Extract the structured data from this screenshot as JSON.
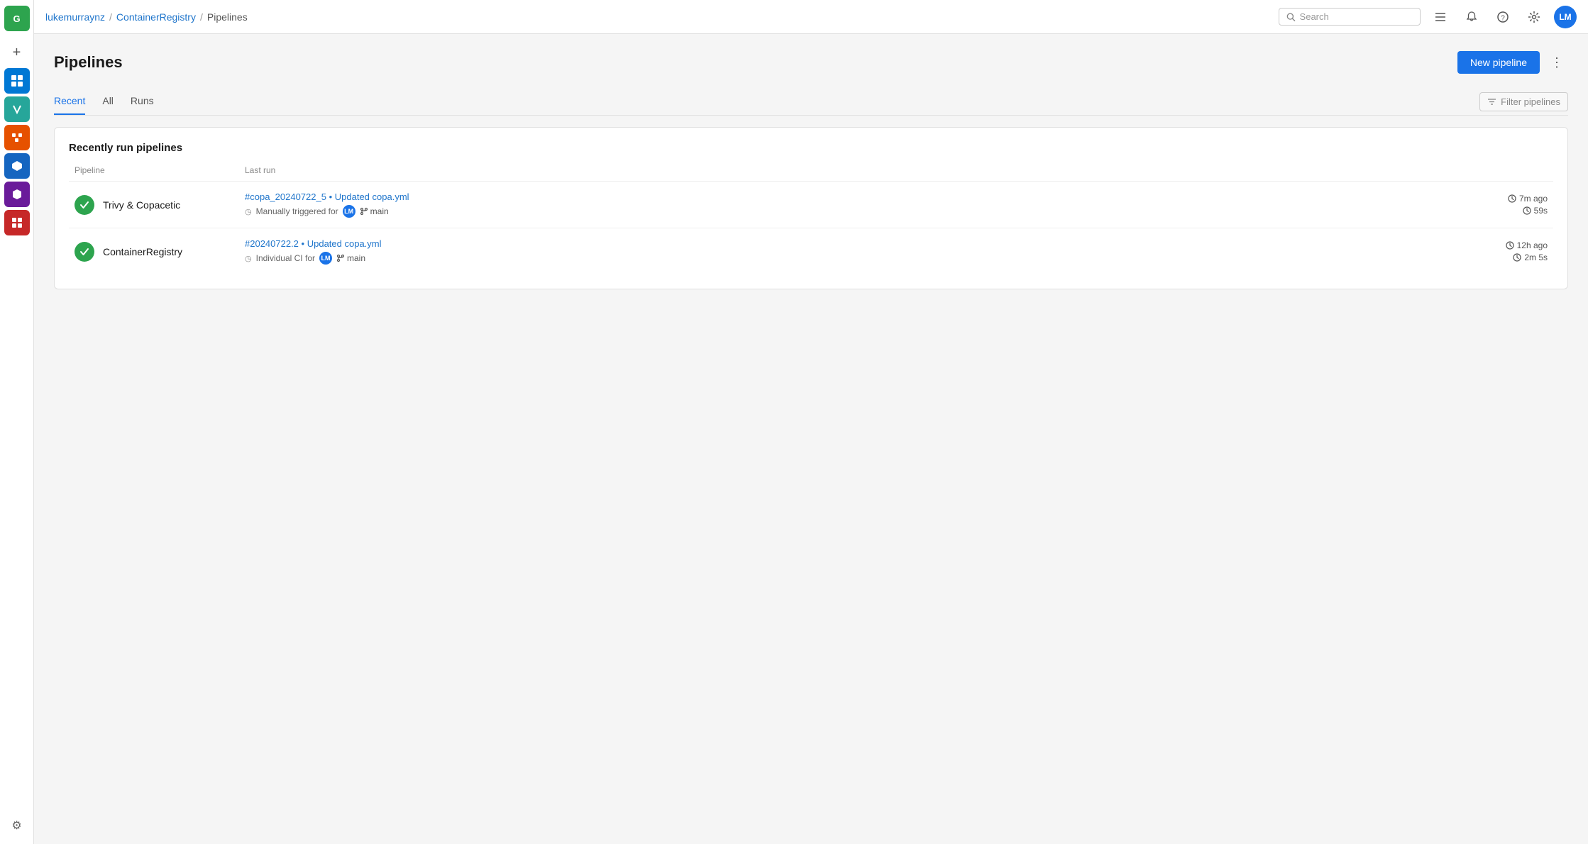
{
  "app": {
    "logo_text": "G"
  },
  "topnav": {
    "breadcrumb": {
      "user": "lukemurraynz",
      "sep1": "/",
      "project": "ContainerRegistry",
      "sep2": "/",
      "page": "Pipelines"
    },
    "search": {
      "placeholder": "Search"
    },
    "avatar": {
      "initials": "LM"
    }
  },
  "sidebar": {
    "items": [
      {
        "id": "overview",
        "icon": "⊞",
        "color": "green"
      },
      {
        "id": "add",
        "icon": "+",
        "color": ""
      },
      {
        "id": "boards",
        "icon": "▦",
        "color": "blue-icon"
      },
      {
        "id": "repos",
        "icon": "✓",
        "color": "teal"
      },
      {
        "id": "pipelines",
        "icon": "⚙",
        "color": "orange"
      },
      {
        "id": "testplans",
        "icon": "⬡",
        "color": "blue-icon"
      },
      {
        "id": "artifacts",
        "icon": "⬢",
        "color": "purple"
      },
      {
        "id": "more",
        "icon": "■",
        "color": "red"
      }
    ],
    "settings_icon": "⚙"
  },
  "page": {
    "title": "Pipelines",
    "new_pipeline_btn": "New pipeline",
    "more_icon": "⋮"
  },
  "tabs": [
    {
      "id": "recent",
      "label": "Recent",
      "active": true
    },
    {
      "id": "all",
      "label": "All",
      "active": false
    },
    {
      "id": "runs",
      "label": "Runs",
      "active": false
    }
  ],
  "filter": {
    "placeholder": "Filter pipelines"
  },
  "pipelines_section": {
    "title": "Recently run pipelines",
    "col_pipeline": "Pipeline",
    "col_lastrun": "Last run",
    "pipelines": [
      {
        "id": 1,
        "name": "Trivy & Copacetic",
        "status": "success",
        "commit_ref": "#copa_20240722_5",
        "commit_msg": "Updated copa.yml",
        "trigger": "Manually triggered for",
        "user_initials": "LM",
        "branch": "main",
        "time_ago": "7m ago",
        "duration": "59s"
      },
      {
        "id": 2,
        "name": "ContainerRegistry",
        "status": "success",
        "commit_ref": "#20240722.2",
        "commit_msg": "Updated copa.yml",
        "trigger": "Individual CI for",
        "user_initials": "LM",
        "branch": "main",
        "time_ago": "12h ago",
        "duration": "2m 5s"
      }
    ]
  }
}
